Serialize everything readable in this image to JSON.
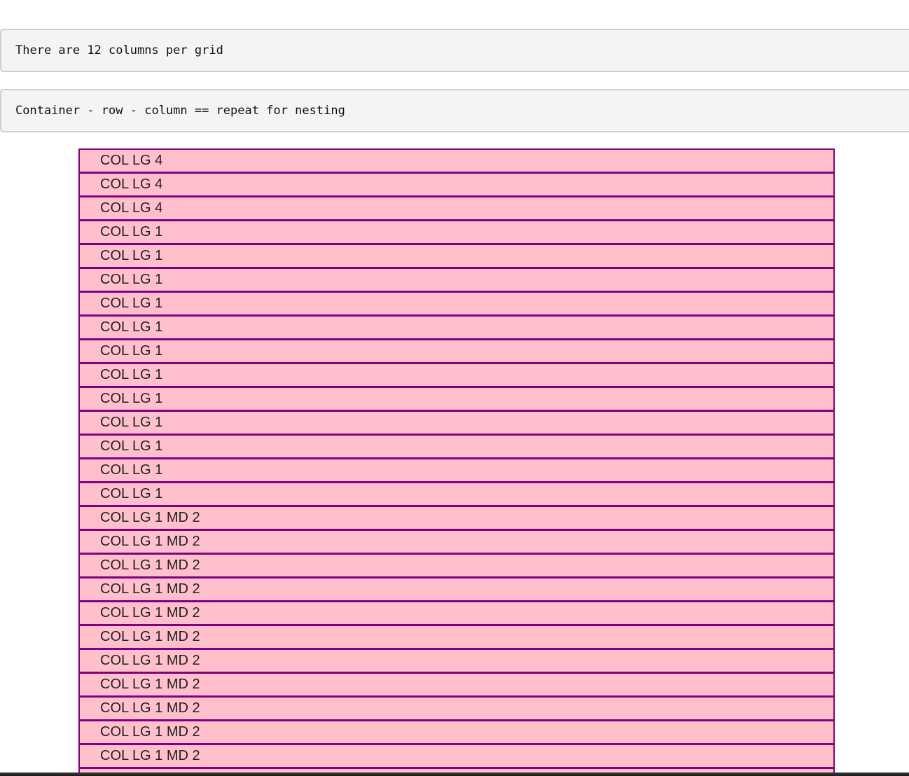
{
  "notes": [
    "There are 12 columns per grid",
    "Container - row - column == repeat for nesting"
  ],
  "columns": [
    "COL LG 4",
    "COL LG 4",
    "COL LG 4",
    "COL LG 1",
    "COL LG 1",
    "COL LG 1",
    "COL LG 1",
    "COL LG 1",
    "COL LG 1",
    "COL LG 1",
    "COL LG 1",
    "COL LG 1",
    "COL LG 1",
    "COL LG 1",
    "COL LG 1",
    "COL LG 1 MD 2",
    "COL LG 1 MD 2",
    "COL LG 1 MD 2",
    "COL LG 1 MD 2",
    "COL LG 1 MD 2",
    "COL LG 1 MD 2",
    "COL LG 1 MD 2",
    "COL LG 1 MD 2",
    "COL LG 1 MD 2",
    "COL LG 1 MD 2",
    "COL LG 1 MD 2"
  ],
  "colors": {
    "column_background": "#ffc0cb",
    "column_border": "#800080",
    "note_background": "#f4f4f4"
  }
}
